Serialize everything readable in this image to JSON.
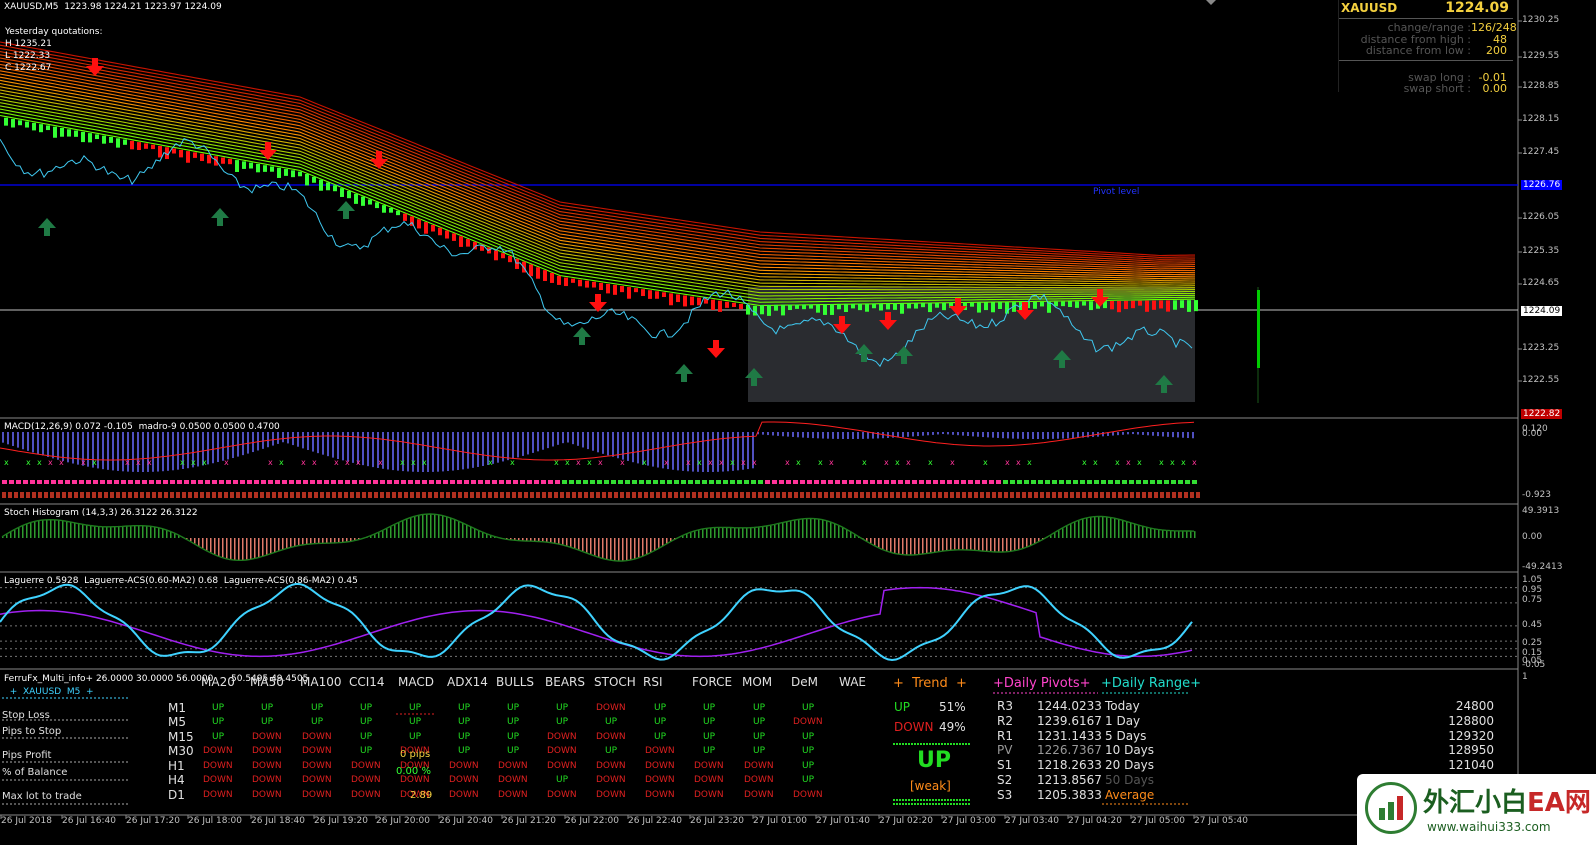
{
  "colors": {
    "bg": "#000000",
    "grid": "#1f1f1f",
    "pivot": "#0000ff",
    "bid": "#c0c0c0",
    "up": "#00ff00",
    "down": "#ff0000",
    "cyan": "#3fd2ff",
    "violet": "#b000ff",
    "arrowUp": "#1f7a45",
    "arrowDown": "#ff0000"
  },
  "main": {
    "header": "XAUUSD,M5  1223.98 1224.21 1223.97 1224.09",
    "yesterday": {
      "title": "Yesterday quotations:",
      "h": "H 1235.21",
      "l": "L 1222.33",
      "c": "C 1222.67"
    },
    "pivot_label": "Pivot level",
    "pivot_price": "1226.76",
    "last_price": "1224.09",
    "low_tag": "1222.82"
  },
  "price_axis": [
    "1230.25",
    "1229.55",
    "1228.85",
    "1228.15",
    "1227.45",
    "1226.05",
    "1225.35",
    "1224.65",
    "1223.25",
    "1222.55"
  ],
  "info_panel": {
    "symbol": "XAUUSD",
    "price": "1224.09",
    "rows": [
      {
        "label": "change/range :",
        "value": "126/248"
      },
      {
        "label": "distance from high :",
        "value": "48"
      },
      {
        "label": "distance from low :",
        "value": "200"
      },
      {
        "label": "swap long :",
        "value": "-0.01"
      },
      {
        "label": "swap short :",
        "value": "0.00"
      }
    ]
  },
  "macd": {
    "label": "MACD(12,26,9) 0.072 -0.105  madro-9 0.0500 0.0500 0.4700",
    "axis": [
      "0.120",
      "0.00",
      "-0.923"
    ]
  },
  "stoch": {
    "label": "Stoch Histogram (14,3,3) 26.3122 26.3122",
    "axis": [
      "49.3913",
      "0.00",
      "-49.2413"
    ]
  },
  "laguerre": {
    "label": "Laguerre 0.5928  Laguerre-ACS(0.60-MA2) 0.68  Laguerre-ACS(0.86-MA2) 0.45",
    "axis": [
      "1.05",
      "0.95",
      "0.75",
      "0.45",
      "0.25",
      "0.15",
      "0.05",
      "-0.05"
    ]
  },
  "multi": {
    "title": "FerruFx_Multi_info+ 26.0000 30.0000 56.0000",
    "subtitle": "  +  XAUUSD  M5  +",
    "extra": "50.5495 49.4505",
    "left_labels": [
      "Stop Loss",
      "Pips to Stop",
      "Pips Profit",
      "% of Balance",
      "Max lot to trade"
    ],
    "mid_values": [
      "0 pips",
      "0.00 %",
      "2.89"
    ],
    "columns": [
      "MA20",
      "MA50",
      "MA100",
      "CCI14",
      "MACD",
      "ADX14",
      "BULLS",
      "BEARS",
      "STOCH",
      "RSI",
      "FORCE",
      "MOM",
      "DeM",
      "WAE"
    ],
    "timeframes": [
      "M1",
      "M5",
      "M15",
      "M30",
      "H1",
      "H4",
      "D1"
    ],
    "grid": [
      [
        "UP",
        "UP",
        "UP",
        "UP",
        "UP",
        "UP",
        "UP",
        "UP",
        "DOWN",
        "UP",
        "UP",
        "UP",
        "UP"
      ],
      [
        "UP",
        "UP",
        "UP",
        "UP",
        "UP",
        "UP",
        "UP",
        "UP",
        "UP",
        "UP",
        "UP",
        "UP",
        "DOWN"
      ],
      [
        "UP",
        "DOWN",
        "DOWN",
        "UP",
        "UP",
        "UP",
        "UP",
        "DOWN",
        "DOWN",
        "UP",
        "UP",
        "UP",
        "UP"
      ],
      [
        "DOWN",
        "DOWN",
        "DOWN",
        "UP",
        "DOWN",
        "UP",
        "UP",
        "DOWN",
        "UP",
        "DOWN",
        "UP",
        "UP",
        "UP"
      ],
      [
        "DOWN",
        "DOWN",
        "DOWN",
        "DOWN",
        "DOWN",
        "DOWN",
        "DOWN",
        "DOWN",
        "DOWN",
        "DOWN",
        "DOWN",
        "DOWN",
        "UP"
      ],
      [
        "DOWN",
        "DOWN",
        "DOWN",
        "DOWN",
        "DOWN",
        "DOWN",
        "DOWN",
        "UP",
        "DOWN",
        "DOWN",
        "DOWN",
        "DOWN",
        "UP"
      ],
      [
        "DOWN",
        "DOWN",
        "DOWN",
        "DOWN",
        "DOWN",
        "DOWN",
        "DOWN",
        "DOWN",
        "DOWN",
        "DOWN",
        "DOWN",
        "DOWN",
        "DOWN"
      ]
    ],
    "trend": {
      "title": "+  Trend  +",
      "up_label": "UP",
      "up_pct": "51%",
      "down_label": "DOWN",
      "down_pct": "49%",
      "signal": "UP",
      "strength": "[weak]"
    },
    "pivots": {
      "title": "+Daily Pivots+",
      "rows": [
        {
          "n": "R3",
          "v": "1244.0233"
        },
        {
          "n": "R2",
          "v": "1239.6167"
        },
        {
          "n": "R1",
          "v": "1231.1433"
        },
        {
          "n": "PV",
          "v": "1226.7367"
        },
        {
          "n": "S1",
          "v": "1218.2633"
        },
        {
          "n": "S2",
          "v": "1213.8567"
        },
        {
          "n": "S3",
          "v": "1205.3833"
        }
      ]
    },
    "range": {
      "title": "+Daily Range+",
      "rows": [
        {
          "n": "Today",
          "v": "24800"
        },
        {
          "n": "1 Day",
          "v": "128800"
        },
        {
          "n": "5 Days",
          "v": "129320"
        },
        {
          "n": "10 Days",
          "v": "128950"
        },
        {
          "n": "20 Days",
          "v": "121040"
        },
        {
          "n": "50 Days",
          "v": ""
        },
        {
          "n": "Average",
          "v": ""
        }
      ]
    }
  },
  "time_axis": [
    "26 Jul 2018",
    "26 Jul 16:40",
    "26 Jul 17:20",
    "26 Jul 18:00",
    "26 Jul 18:40",
    "26 Jul 19:20",
    "26 Jul 20:00",
    "26 Jul 20:40",
    "26 Jul 21:20",
    "26 Jul 22:00",
    "26 Jul 22:40",
    "26 Jul 23:20",
    "27 Jul 01:00",
    "27 Jul 01:40",
    "27 Jul 02:20",
    "27 Jul 03:00",
    "27 Jul 03:40",
    "27 Jul 04:20",
    "27 Jul 05:00",
    "27 Jul 05:40"
  ],
  "watermark": {
    "cn": "外汇小白",
    "ea": "EA网",
    "url": "www.waihui333.com"
  }
}
